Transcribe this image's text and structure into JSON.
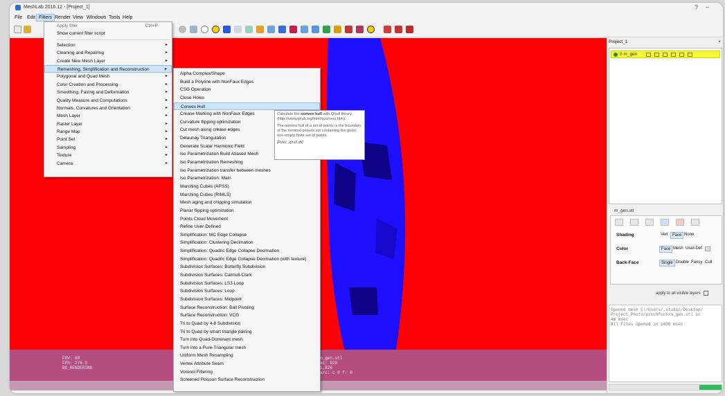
{
  "window": {
    "title": "MeshLab 2016.12 - [Project_1]"
  },
  "menubar": {
    "items": [
      "File",
      "Edit",
      "Filters",
      "Render",
      "View",
      "Windows",
      "Tools",
      "Help"
    ]
  },
  "filters_menu": {
    "apply_filter": "Apply filter",
    "apply_shortcut": "Ctrl+P",
    "show_script": "Show current filter script",
    "items": [
      "Selection",
      "Cleaning and Repairing",
      "Create New Mesh Layer",
      "Remeshing, Simplification and Reconstruction",
      "Polygonal and Quad Mesh",
      "Color Creation and Processing",
      "Smoothing, Fairing and Deformation",
      "Quality Measure and Computations",
      "Normals, Curvatures and Orientation",
      "Mesh Layer",
      "Raster Layer",
      "Range Map",
      "Point Set",
      "Sampling",
      "Texture",
      "Camera"
    ]
  },
  "remesh_submenu": {
    "items": [
      "Alpha Complex/Shape",
      "Build a Polyline with NonFaux Edges",
      "CSG Operation",
      "Close Holes",
      "Convex Hull",
      "Crease Marking with NonFaux Edges",
      "Curvature flipping optimization",
      "Cut mesh along crease edges",
      "Delaunay Triangulation",
      "Generate Scalar Harmonic Field",
      "Iso Parametrization Build Atlased Mesh",
      "Iso Parametrization Remeshing",
      "Iso Parametrization transfer between meshes",
      "Iso Parametrization: Main",
      "Marching Cubes (APSS)",
      "Marching Cubes (RIMLS)",
      "Mesh aging and chipping simulation",
      "Planar flipping optimization",
      "Points Cloud Movement",
      "Refine User-Defined",
      "Simplification: MC Edge Collapse",
      "Simplification: Clustering Decimation",
      "Simplification: Quadric Edge Collapse Decimation",
      "Simplification: Quadric Edge Collapse Decimation (with texture)",
      "Subdivision Surfaces: Butterfly Subdivision",
      "Subdivision Surfaces: Catmull-Clark",
      "Subdivision Surfaces: LS3 Loop",
      "Subdivision Surfaces: Loop",
      "Subdivision Surfaces: Midpoint",
      "Surface Reconstruction: Ball Pivoting",
      "Surface Reconstruction: VCG",
      "Tri to Quad by 4-8 Subdivision",
      "Tri to Quad by smart triangle pairing",
      "Turn into Quad-Dominant mesh",
      "Turn into a Pure-Triangular mesh",
      "Uniform Mesh Resampling",
      "Vertex Attribute Seam",
      "Voronoi Filtering",
      "Screened Poisson Surface Reconstruction"
    ]
  },
  "tooltip": {
    "line1a": "Calculate the ",
    "line1b": "convex hull",
    "line1c": " with Qhull library",
    "line2": "(http://www.qhull.org/html/qconvex.htm).",
    "line3": "The convex hull of a set of points is the boundary of the minimal convex set containing the given non-empty finite set of points.",
    "line4": "[Filter_qhull.dll]"
  },
  "hud": {
    "left": [
      "FOV: 60",
      "FPS:  278.3",
      "BO_RENDERING"
    ],
    "right": [
      "m_gen.stl",
      "ac: 928",
      "1,826",
      "arc: c 0 f: 0"
    ]
  },
  "right_panel": {
    "project_title": "Project_1",
    "close_glyph": "×",
    "layer_name": "0  m_gen",
    "mesh_file": "m_gen.stl",
    "shading": {
      "label": "Shading",
      "options": [
        "Vert",
        "Face",
        "None"
      ],
      "selected": "Face"
    },
    "color": {
      "label": "Color",
      "options": [
        "Face",
        "Mesh",
        "User-Def"
      ],
      "selected": "Face"
    },
    "backface": {
      "label": "Back-Face",
      "options": [
        "Single",
        "Double",
        "Fancy",
        "Cull"
      ],
      "selected": "Single"
    },
    "apply_all": "apply to all visible layers",
    "log": [
      "Opened mesh C:/Users/.studio/Desktop/",
      "Project_Photo/pinchfuch/m_gen.stl in",
      "46 msec",
      "All files opened in 1406 msec"
    ],
    "progress": 0.2
  },
  "colors": {
    "background": "#fc0207",
    "mesh": "#1e0fff",
    "mesh_dark": "#0d0488",
    "highlight": "#cde3f8"
  }
}
